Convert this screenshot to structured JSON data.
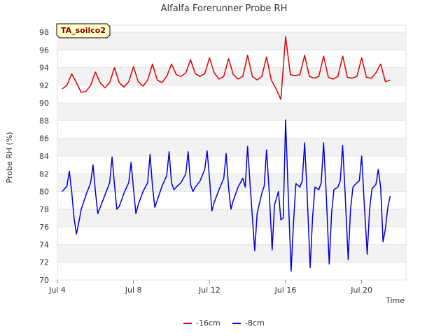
{
  "chart_data": {
    "type": "line",
    "title": "Alfalfa Forerunner Probe RH",
    "site_badge": "TA_soilco2",
    "xlabel": "Time",
    "ylabel": "Probe RH (%)",
    "xlim": [
      "2024-07-04",
      "2024-07-22"
    ],
    "ylim": [
      70,
      98
    ],
    "y_ticks": [
      70,
      72,
      74,
      76,
      78,
      80,
      82,
      84,
      86,
      88,
      90,
      92,
      94,
      96,
      98
    ],
    "x_ticks": [
      {
        "date": "2024-07-04",
        "label": "Jul 4"
      },
      {
        "date": "2024-07-08",
        "label": "Jul 8"
      },
      {
        "date": "2024-07-12",
        "label": "Jul 12"
      },
      {
        "date": "2024-07-16",
        "label": "Jul 16"
      },
      {
        "date": "2024-07-20",
        "label": "Jul 20"
      }
    ],
    "grid": "horizontal alternating bands",
    "legend_position": "bottom-center",
    "series": [
      {
        "name": "-16cm",
        "color": "#dd0000",
        "points": [
          [
            "2024-07-04T06:00",
            91.6
          ],
          [
            "2024-07-04T12:00",
            92.0
          ],
          [
            "2024-07-04T18:00",
            93.3
          ],
          [
            "2024-07-05T00:00",
            92.3
          ],
          [
            "2024-07-05T06:00",
            91.2
          ],
          [
            "2024-07-05T12:00",
            91.3
          ],
          [
            "2024-07-05T18:00",
            92.0
          ],
          [
            "2024-07-06T00:00",
            93.5
          ],
          [
            "2024-07-06T06:00",
            92.3
          ],
          [
            "2024-07-06T12:00",
            91.7
          ],
          [
            "2024-07-06T18:00",
            92.3
          ],
          [
            "2024-07-07T00:00",
            94.0
          ],
          [
            "2024-07-07T06:00",
            92.3
          ],
          [
            "2024-07-07T12:00",
            91.8
          ],
          [
            "2024-07-07T18:00",
            92.4
          ],
          [
            "2024-07-08T00:00",
            94.1
          ],
          [
            "2024-07-08T06:00",
            92.4
          ],
          [
            "2024-07-08T12:00",
            91.9
          ],
          [
            "2024-07-08T18:00",
            92.6
          ],
          [
            "2024-07-09T00:00",
            94.4
          ],
          [
            "2024-07-09T06:00",
            92.6
          ],
          [
            "2024-07-09T12:00",
            92.3
          ],
          [
            "2024-07-09T18:00",
            93.0
          ],
          [
            "2024-07-10T00:00",
            94.4
          ],
          [
            "2024-07-10T06:00",
            93.2
          ],
          [
            "2024-07-10T12:00",
            93.0
          ],
          [
            "2024-07-10T18:00",
            93.4
          ],
          [
            "2024-07-11T00:00",
            94.9
          ],
          [
            "2024-07-11T06:00",
            93.3
          ],
          [
            "2024-07-11T12:00",
            93.0
          ],
          [
            "2024-07-11T18:00",
            93.3
          ],
          [
            "2024-07-12T00:00",
            95.1
          ],
          [
            "2024-07-12T06:00",
            93.4
          ],
          [
            "2024-07-12T12:00",
            92.7
          ],
          [
            "2024-07-12T18:00",
            93.0
          ],
          [
            "2024-07-13T00:00",
            95.0
          ],
          [
            "2024-07-13T06:00",
            93.2
          ],
          [
            "2024-07-13T12:00",
            92.7
          ],
          [
            "2024-07-13T18:00",
            93.0
          ],
          [
            "2024-07-14T00:00",
            95.4
          ],
          [
            "2024-07-14T06:00",
            93.0
          ],
          [
            "2024-07-14T12:00",
            92.6
          ],
          [
            "2024-07-14T18:00",
            93.0
          ],
          [
            "2024-07-15T00:00",
            95.2
          ],
          [
            "2024-07-15T06:00",
            92.6
          ],
          [
            "2024-07-15T12:00",
            91.6
          ],
          [
            "2024-07-15T18:00",
            90.4
          ],
          [
            "2024-07-16T00:00",
            97.5
          ],
          [
            "2024-07-16T06:00",
            93.2
          ],
          [
            "2024-07-16T12:00",
            93.1
          ],
          [
            "2024-07-16T18:00",
            93.2
          ],
          [
            "2024-07-17T00:00",
            95.4
          ],
          [
            "2024-07-17T06:00",
            93.0
          ],
          [
            "2024-07-17T12:00",
            92.8
          ],
          [
            "2024-07-17T18:00",
            93.0
          ],
          [
            "2024-07-18T00:00",
            95.3
          ],
          [
            "2024-07-18T06:00",
            92.9
          ],
          [
            "2024-07-18T12:00",
            92.7
          ],
          [
            "2024-07-18T18:00",
            93.0
          ],
          [
            "2024-07-19T00:00",
            95.3
          ],
          [
            "2024-07-19T06:00",
            92.9
          ],
          [
            "2024-07-19T12:00",
            92.8
          ],
          [
            "2024-07-19T18:00",
            93.0
          ],
          [
            "2024-07-20T00:00",
            95.1
          ],
          [
            "2024-07-20T06:00",
            92.9
          ],
          [
            "2024-07-20T12:00",
            92.8
          ],
          [
            "2024-07-20T18:00",
            93.4
          ],
          [
            "2024-07-21T00:00",
            94.4
          ],
          [
            "2024-07-21T06:00",
            92.4
          ],
          [
            "2024-07-21T12:00",
            92.6
          ]
        ]
      },
      {
        "name": "-8cm",
        "color": "#0000dd",
        "points": [
          [
            "2024-07-04T06:00",
            80.0
          ],
          [
            "2024-07-04T12:00",
            80.6
          ],
          [
            "2024-07-04T15:00",
            82.3
          ],
          [
            "2024-07-04T18:00",
            80.0
          ],
          [
            "2024-07-04T21:00",
            77.0
          ],
          [
            "2024-07-05T00:00",
            75.2
          ],
          [
            "2024-07-05T03:00",
            76.5
          ],
          [
            "2024-07-05T06:00",
            78.0
          ],
          [
            "2024-07-05T12:00",
            79.6
          ],
          [
            "2024-07-05T18:00",
            81.0
          ],
          [
            "2024-07-05T21:00",
            83.0
          ],
          [
            "2024-07-06T00:00",
            80.0
          ],
          [
            "2024-07-06T03:00",
            77.5
          ],
          [
            "2024-07-06T06:00",
            78.2
          ],
          [
            "2024-07-06T12:00",
            79.6
          ],
          [
            "2024-07-06T18:00",
            81.0
          ],
          [
            "2024-07-06T21:00",
            83.9
          ],
          [
            "2024-07-07T00:00",
            80.8
          ],
          [
            "2024-07-07T03:00",
            78.0
          ],
          [
            "2024-07-07T06:00",
            78.3
          ],
          [
            "2024-07-07T12:00",
            79.8
          ],
          [
            "2024-07-07T18:00",
            81.0
          ],
          [
            "2024-07-07T21:00",
            83.3
          ],
          [
            "2024-07-08T00:00",
            80.3
          ],
          [
            "2024-07-08T03:00",
            77.5
          ],
          [
            "2024-07-08T06:00",
            78.5
          ],
          [
            "2024-07-08T12:00",
            80.0
          ],
          [
            "2024-07-08T18:00",
            81.0
          ],
          [
            "2024-07-08T21:00",
            84.2
          ],
          [
            "2024-07-09T00:00",
            80.6
          ],
          [
            "2024-07-09T03:00",
            78.2
          ],
          [
            "2024-07-09T06:00",
            79.0
          ],
          [
            "2024-07-09T12:00",
            80.6
          ],
          [
            "2024-07-09T18:00",
            81.8
          ],
          [
            "2024-07-09T21:00",
            84.5
          ],
          [
            "2024-07-10T00:00",
            81.0
          ],
          [
            "2024-07-10T03:00",
            80.2
          ],
          [
            "2024-07-10T06:00",
            80.5
          ],
          [
            "2024-07-10T12:00",
            81.0
          ],
          [
            "2024-07-10T18:00",
            82.0
          ],
          [
            "2024-07-10T21:00",
            84.5
          ],
          [
            "2024-07-11T00:00",
            80.8
          ],
          [
            "2024-07-11T03:00",
            80.0
          ],
          [
            "2024-07-11T06:00",
            80.5
          ],
          [
            "2024-07-11T12:00",
            81.2
          ],
          [
            "2024-07-11T18:00",
            82.5
          ],
          [
            "2024-07-11T21:00",
            84.6
          ],
          [
            "2024-07-12T00:00",
            81.5
          ],
          [
            "2024-07-12T03:00",
            77.8
          ],
          [
            "2024-07-12T06:00",
            78.8
          ],
          [
            "2024-07-12T12:00",
            80.2
          ],
          [
            "2024-07-12T18:00",
            81.5
          ],
          [
            "2024-07-12T21:00",
            84.3
          ],
          [
            "2024-07-13T00:00",
            80.5
          ],
          [
            "2024-07-13T03:00",
            78.0
          ],
          [
            "2024-07-13T06:00",
            79.0
          ],
          [
            "2024-07-13T12:00",
            80.5
          ],
          [
            "2024-07-13T18:00",
            81.5
          ],
          [
            "2024-07-13T21:00",
            80.5
          ],
          [
            "2024-07-14T00:00",
            85.1
          ],
          [
            "2024-07-14T03:00",
            81.0
          ],
          [
            "2024-07-14T09:00",
            73.3
          ],
          [
            "2024-07-14T12:00",
            77.5
          ],
          [
            "2024-07-14T18:00",
            79.8
          ],
          [
            "2024-07-14T21:00",
            80.6
          ],
          [
            "2024-07-15T00:00",
            84.7
          ],
          [
            "2024-07-15T03:00",
            80.5
          ],
          [
            "2024-07-15T07:00",
            73.4
          ],
          [
            "2024-07-15T10:00",
            78.5
          ],
          [
            "2024-07-15T15:00",
            80.0
          ],
          [
            "2024-07-15T18:00",
            76.8
          ],
          [
            "2024-07-15T21:00",
            77.0
          ],
          [
            "2024-07-16T00:00",
            88.1
          ],
          [
            "2024-07-16T03:00",
            80.5
          ],
          [
            "2024-07-16T07:00",
            71.0
          ],
          [
            "2024-07-16T10:00",
            76.5
          ],
          [
            "2024-07-16T13:00",
            80.9
          ],
          [
            "2024-07-16T18:00",
            80.5
          ],
          [
            "2024-07-16T21:00",
            81.2
          ],
          [
            "2024-07-17T00:00",
            85.5
          ],
          [
            "2024-07-17T03:00",
            80.0
          ],
          [
            "2024-07-17T07:00",
            71.4
          ],
          [
            "2024-07-17T10:00",
            77.0
          ],
          [
            "2024-07-17T13:00",
            80.5
          ],
          [
            "2024-07-17T18:00",
            80.2
          ],
          [
            "2024-07-17T21:00",
            81.0
          ],
          [
            "2024-07-18T00:00",
            85.5
          ],
          [
            "2024-07-18T03:00",
            80.3
          ],
          [
            "2024-07-18T07:00",
            71.8
          ],
          [
            "2024-07-18T10:00",
            77.5
          ],
          [
            "2024-07-18T13:00",
            80.2
          ],
          [
            "2024-07-18T18:00",
            80.5
          ],
          [
            "2024-07-18T21:00",
            81.2
          ],
          [
            "2024-07-19T00:00",
            85.2
          ],
          [
            "2024-07-19T03:00",
            80.0
          ],
          [
            "2024-07-19T07:00",
            72.3
          ],
          [
            "2024-07-19T10:00",
            78.0
          ],
          [
            "2024-07-19T13:00",
            80.5
          ],
          [
            "2024-07-19T18:00",
            81.0
          ],
          [
            "2024-07-19T21:00",
            81.2
          ],
          [
            "2024-07-20T00:00",
            84.0
          ],
          [
            "2024-07-20T03:00",
            79.0
          ],
          [
            "2024-07-20T07:00",
            72.9
          ],
          [
            "2024-07-20T10:00",
            78.0
          ],
          [
            "2024-07-20T13:00",
            80.3
          ],
          [
            "2024-07-20T18:00",
            80.8
          ],
          [
            "2024-07-20T21:00",
            82.5
          ],
          [
            "2024-07-21T00:00",
            80.5
          ],
          [
            "2024-07-21T03:00",
            74.3
          ],
          [
            "2024-07-21T06:00",
            75.8
          ],
          [
            "2024-07-21T09:00",
            78.2
          ],
          [
            "2024-07-21T12:00",
            79.5
          ]
        ]
      }
    ]
  }
}
